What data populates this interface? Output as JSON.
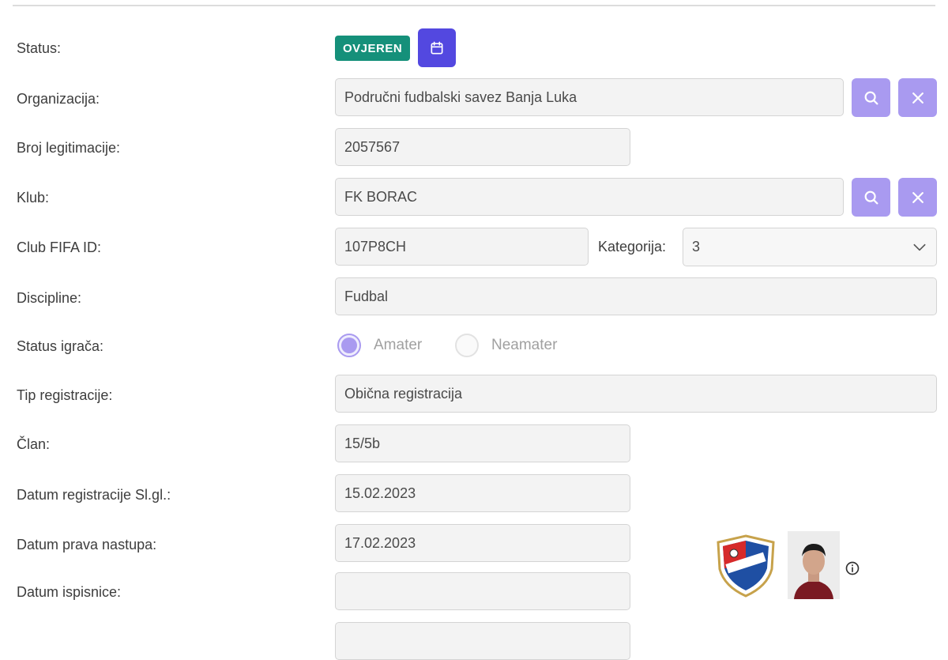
{
  "status": {
    "label": "Status:",
    "badge": "OVJEREN"
  },
  "organizacija": {
    "label": "Organizacija:",
    "value": "Područni fudbalski savez Banja Luka"
  },
  "broj_legitimacije": {
    "label": "Broj legitimacije:",
    "value": "2057567"
  },
  "klub": {
    "label": "Klub:",
    "value": "FK BORAC"
  },
  "club_fifa_id": {
    "label": "Club FIFA ID:",
    "value": "107P8CH"
  },
  "kategorija": {
    "label": "Kategorija:",
    "value": "3"
  },
  "discipline": {
    "label": "Discipline:",
    "value": "Fudbal"
  },
  "status_igraca": {
    "label": "Status igrača:",
    "options": [
      "Amater",
      "Neamater"
    ],
    "selected": "Amater"
  },
  "tip_registracije": {
    "label": "Tip registracije:",
    "value": "Obična registracija"
  },
  "clan": {
    "label": "Član:",
    "value": "15/5b"
  },
  "datum_registracije": {
    "label": "Datum registracije Sl.gl.:",
    "value": "15.02.2023"
  },
  "datum_prava_nastupa": {
    "label": "Datum prava nastupa:",
    "value": "17.02.2023"
  },
  "datum_ispisnice": {
    "label": "Datum ispisnice:",
    "value": ""
  },
  "icons": {
    "calendar": "calendar-icon",
    "search": "search-icon",
    "clear": "close-icon",
    "dropdown": "chevron-down-icon",
    "info": "info-icon"
  },
  "colors": {
    "badge": "#15907a",
    "calendar_button": "#5348e0",
    "action_button": "#a99af0",
    "field_background": "#f3f3f3"
  }
}
